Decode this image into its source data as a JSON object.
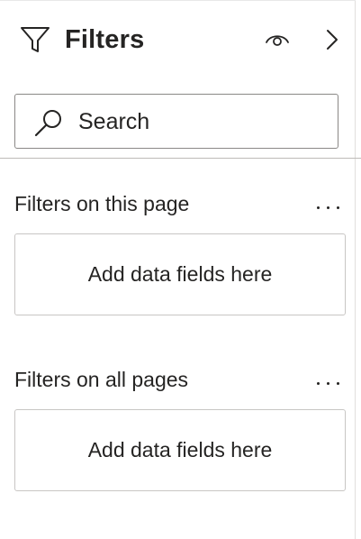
{
  "header": {
    "title": "Filters",
    "filter_icon": "filter-funnel-icon",
    "visibility_icon": "eye-icon",
    "collapse_icon": "chevron-right-icon"
  },
  "search": {
    "placeholder": "Search",
    "value": "",
    "icon": "search-icon"
  },
  "sections": [
    {
      "label": "Filters on this page",
      "more_icon": "ellipsis-icon",
      "drop_text": "Add data fields here"
    },
    {
      "label": "Filters on all pages",
      "more_icon": "ellipsis-icon",
      "drop_text": "Add data fields here"
    }
  ],
  "colors": {
    "text": "#252423",
    "border": "#8a8886",
    "well_border": "#c8c6c4",
    "divider": "#bebbb8"
  }
}
